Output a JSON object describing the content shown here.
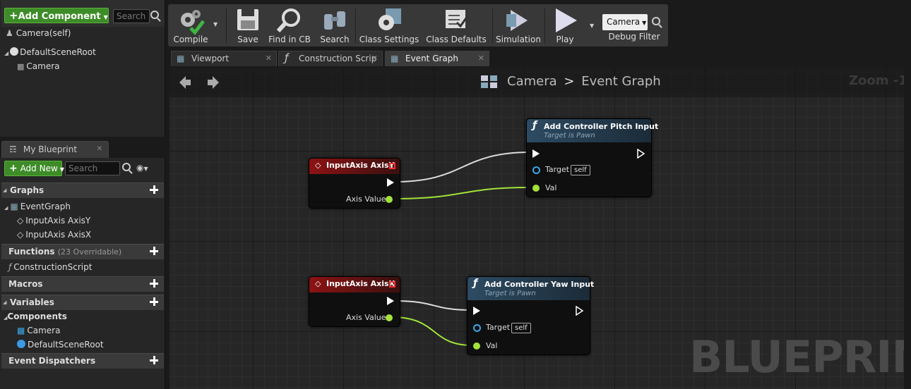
{
  "components_panel": {
    "add_component_label": "Add Component",
    "search_placeholder": "Search",
    "self_item": "Camera(self)",
    "tree": [
      "DefaultSceneRoot",
      "Camera"
    ]
  },
  "my_blueprint": {
    "tab_label": "My Blueprint",
    "add_new_label": "Add New",
    "search_placeholder": "Search",
    "graphs_label": "Graphs",
    "graphs": [
      "EventGraph",
      "InputAxis AxisY",
      "InputAxis AxisX"
    ],
    "functions_label": "Functions",
    "functions_note": "(23 Overridable)",
    "functions": [
      "ConstructionScript"
    ],
    "macros_label": "Macros",
    "variables_label": "Variables",
    "components_label": "Components",
    "components": [
      "Camera",
      "DefaultSceneRoot"
    ],
    "event_dispatchers_label": "Event Dispatchers"
  },
  "toolbar": {
    "compile": "Compile",
    "save": "Save",
    "find_in_cb": "Find in CB",
    "search": "Search",
    "class_settings": "Class Settings",
    "class_defaults": "Class Defaults",
    "simulation": "Simulation",
    "play": "Play",
    "debug_select": "Camera",
    "debug_filter": "Debug Filter"
  },
  "tabs": [
    "Viewport",
    "Construction Scrip",
    "Event Graph"
  ],
  "graph": {
    "breadcrumb_root": "Camera",
    "breadcrumb_sep": ">",
    "breadcrumb_current": "Event Graph",
    "zoom": "Zoom -1",
    "watermark": "BLUEPRINT",
    "nodes": {
      "axis_y": {
        "title": "InputAxis AxisY",
        "pin": "Axis Value"
      },
      "pitch": {
        "title": "Add Controller Pitch Input",
        "subtitle": "Target is Pawn",
        "target": "Target",
        "self": "self",
        "val": "Val"
      },
      "axis_x": {
        "title": "InputAxis AxisX",
        "pin": "Axis Value"
      },
      "yaw": {
        "title": "Add Controller Yaw Input",
        "subtitle": "Target is Pawn",
        "target": "Target",
        "self": "self",
        "val": "Val"
      }
    }
  },
  "colors": {
    "accent_green": "#3d8c28",
    "event_red": "#8c1313",
    "function_blue": "#2d4b62",
    "float_pin": "#a3e23a",
    "object_pin": "#3aa8e8"
  }
}
